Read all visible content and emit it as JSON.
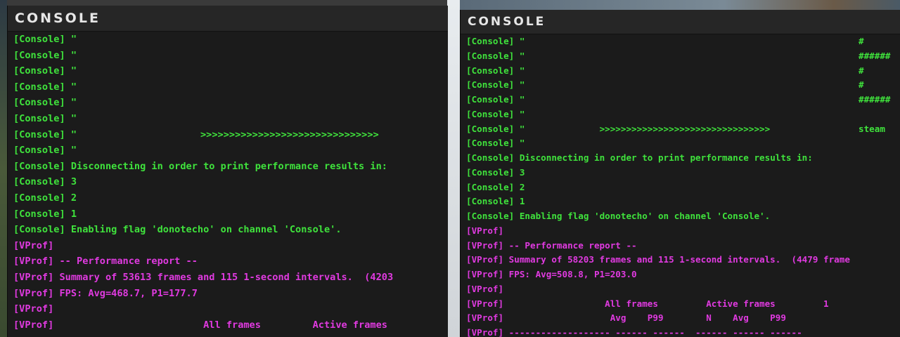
{
  "colors": {
    "console": "#3fe23c",
    "vprof": "#e03ae0",
    "panel_bg": "#1b1b1b",
    "title": "#e6e6e6"
  },
  "left": {
    "title": "CONSOLE",
    "lines": [
      {
        "tag": "[Console]",
        "text": " \"",
        "extra": "",
        "kind": "console"
      },
      {
        "tag": "[Console]",
        "text": " \"",
        "extra": "",
        "kind": "console"
      },
      {
        "tag": "[Console]",
        "text": " \"",
        "extra": "",
        "kind": "console"
      },
      {
        "tag": "[Console]",
        "text": " \"",
        "extra": "",
        "kind": "console"
      },
      {
        "tag": "[Console]",
        "text": " \"",
        "extra": "",
        "kind": "console"
      },
      {
        "tag": "[Console]",
        "text": " \"",
        "extra": "",
        "kind": "console"
      },
      {
        "tag": "[Console]",
        "text": " \"",
        "extra": ">>>>>>>>>>>>>>>>>>>>>>>>>>>>>>>",
        "kind": "console"
      },
      {
        "tag": "[Console]",
        "text": " \"",
        "extra": "",
        "kind": "console"
      },
      {
        "tag": "[Console]",
        "text": " Disconnecting in order to print performance results in:",
        "extra": "",
        "kind": "console"
      },
      {
        "tag": "[Console]",
        "text": " 3",
        "extra": "",
        "kind": "console"
      },
      {
        "tag": "[Console]",
        "text": " 2",
        "extra": "",
        "kind": "console"
      },
      {
        "tag": "[Console]",
        "text": " 1",
        "extra": "",
        "kind": "console"
      },
      {
        "tag": "[Console]",
        "text": " Enabling flag 'donotecho' on channel 'Console'.",
        "extra": "",
        "kind": "console"
      },
      {
        "tag": "[VProf]",
        "text": "",
        "extra": "",
        "kind": "vprof"
      },
      {
        "tag": "[VProf]",
        "text": " -- Performance report --",
        "extra": "",
        "kind": "vprof"
      },
      {
        "tag": "[VProf]",
        "text": " Summary of 53613 frames and 115 1-second intervals.  (4203",
        "extra": "",
        "kind": "vprof"
      },
      {
        "tag": "[VProf]",
        "text": " FPS: Avg=468.7, P1=177.7",
        "extra": "",
        "kind": "vprof"
      },
      {
        "tag": "[VProf]",
        "text": "",
        "extra": "",
        "kind": "vprof"
      },
      {
        "tag": "[VProf]",
        "text": "                          All frames         Active frames",
        "extra": "",
        "kind": "vprof"
      }
    ]
  },
  "right": {
    "title": "CONSOLE",
    "lines": [
      {
        "tag": "[Console]",
        "text": " \"",
        "extra": "#",
        "kind": "console"
      },
      {
        "tag": "[Console]",
        "text": " \"",
        "extra": "######",
        "kind": "console"
      },
      {
        "tag": "[Console]",
        "text": " \"",
        "extra": "#",
        "kind": "console"
      },
      {
        "tag": "[Console]",
        "text": " \"",
        "extra": "#",
        "kind": "console"
      },
      {
        "tag": "[Console]",
        "text": " \"",
        "extra": "######",
        "kind": "console"
      },
      {
        "tag": "[Console]",
        "text": " \"",
        "extra": "",
        "kind": "console"
      },
      {
        "tag": "[Console]",
        "text": " \"              >>>>>>>>>>>>>>>>>>>>>>>>>>>>>>>>",
        "extra": "steam",
        "kind": "console"
      },
      {
        "tag": "[Console]",
        "text": " \"",
        "extra": "",
        "kind": "console"
      },
      {
        "tag": "[Console]",
        "text": " Disconnecting in order to print performance results in:",
        "extra": "",
        "kind": "console"
      },
      {
        "tag": "[Console]",
        "text": " 3",
        "extra": "",
        "kind": "console"
      },
      {
        "tag": "[Console]",
        "text": " 2",
        "extra": "",
        "kind": "console"
      },
      {
        "tag": "[Console]",
        "text": " 1",
        "extra": "",
        "kind": "console"
      },
      {
        "tag": "[Console]",
        "text": " Enabling flag 'donotecho' on channel 'Console'.",
        "extra": "",
        "kind": "console"
      },
      {
        "tag": "[VProf]",
        "text": "",
        "extra": "",
        "kind": "vprof"
      },
      {
        "tag": "[VProf]",
        "text": " -- Performance report --",
        "extra": "",
        "kind": "vprof"
      },
      {
        "tag": "[VProf]",
        "text": " Summary of 58203 frames and 115 1-second intervals.  (4479 frame",
        "extra": "",
        "kind": "vprof"
      },
      {
        "tag": "[VProf]",
        "text": " FPS: Avg=508.8, P1=203.0",
        "extra": "",
        "kind": "vprof"
      },
      {
        "tag": "[VProf]",
        "text": "",
        "extra": "",
        "kind": "vprof"
      },
      {
        "tag": "[VProf]",
        "text": "                   All frames         Active frames         1",
        "extra": "",
        "kind": "vprof"
      },
      {
        "tag": "[VProf]",
        "text": "                    Avg    P99        N    Avg    P99",
        "extra": "",
        "kind": "vprof"
      },
      {
        "tag": "[VProf]",
        "text": " ------------------- ------ ------  ------ ------ ------",
        "extra": "",
        "kind": "vprof"
      }
    ]
  }
}
